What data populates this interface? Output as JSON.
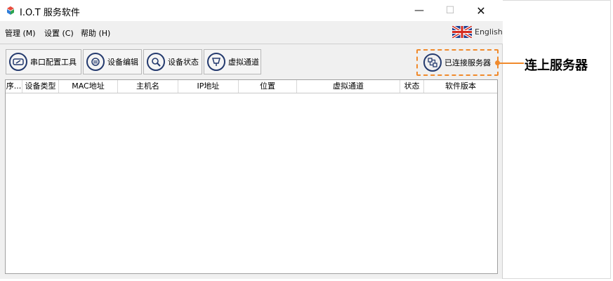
{
  "window": {
    "title": "I.O.T 服务软件"
  },
  "menu": {
    "items": [
      "管理 (M)",
      "设置 (C)",
      "帮助 (H)"
    ]
  },
  "language": {
    "label": "English"
  },
  "toolbar": {
    "buttons": [
      {
        "label": "串口配置工具",
        "icon": "serial-tool-icon"
      },
      {
        "label": "设备编辑",
        "icon": "device-edit-icon"
      },
      {
        "label": "设备状态",
        "icon": "device-status-icon"
      },
      {
        "label": "虚拟通道",
        "icon": "virtual-channel-icon"
      }
    ],
    "server_status": {
      "label": "已连接服务器",
      "icon": "server-connected-icon"
    }
  },
  "callout": {
    "text": "连上服务器",
    "color": "#f08a2c"
  },
  "table": {
    "columns": [
      "序...",
      "设备类型",
      "MAC地址",
      "主机名",
      "IP地址",
      "位置",
      "虚拟通道",
      "状态",
      "软件版本"
    ],
    "rows": []
  }
}
